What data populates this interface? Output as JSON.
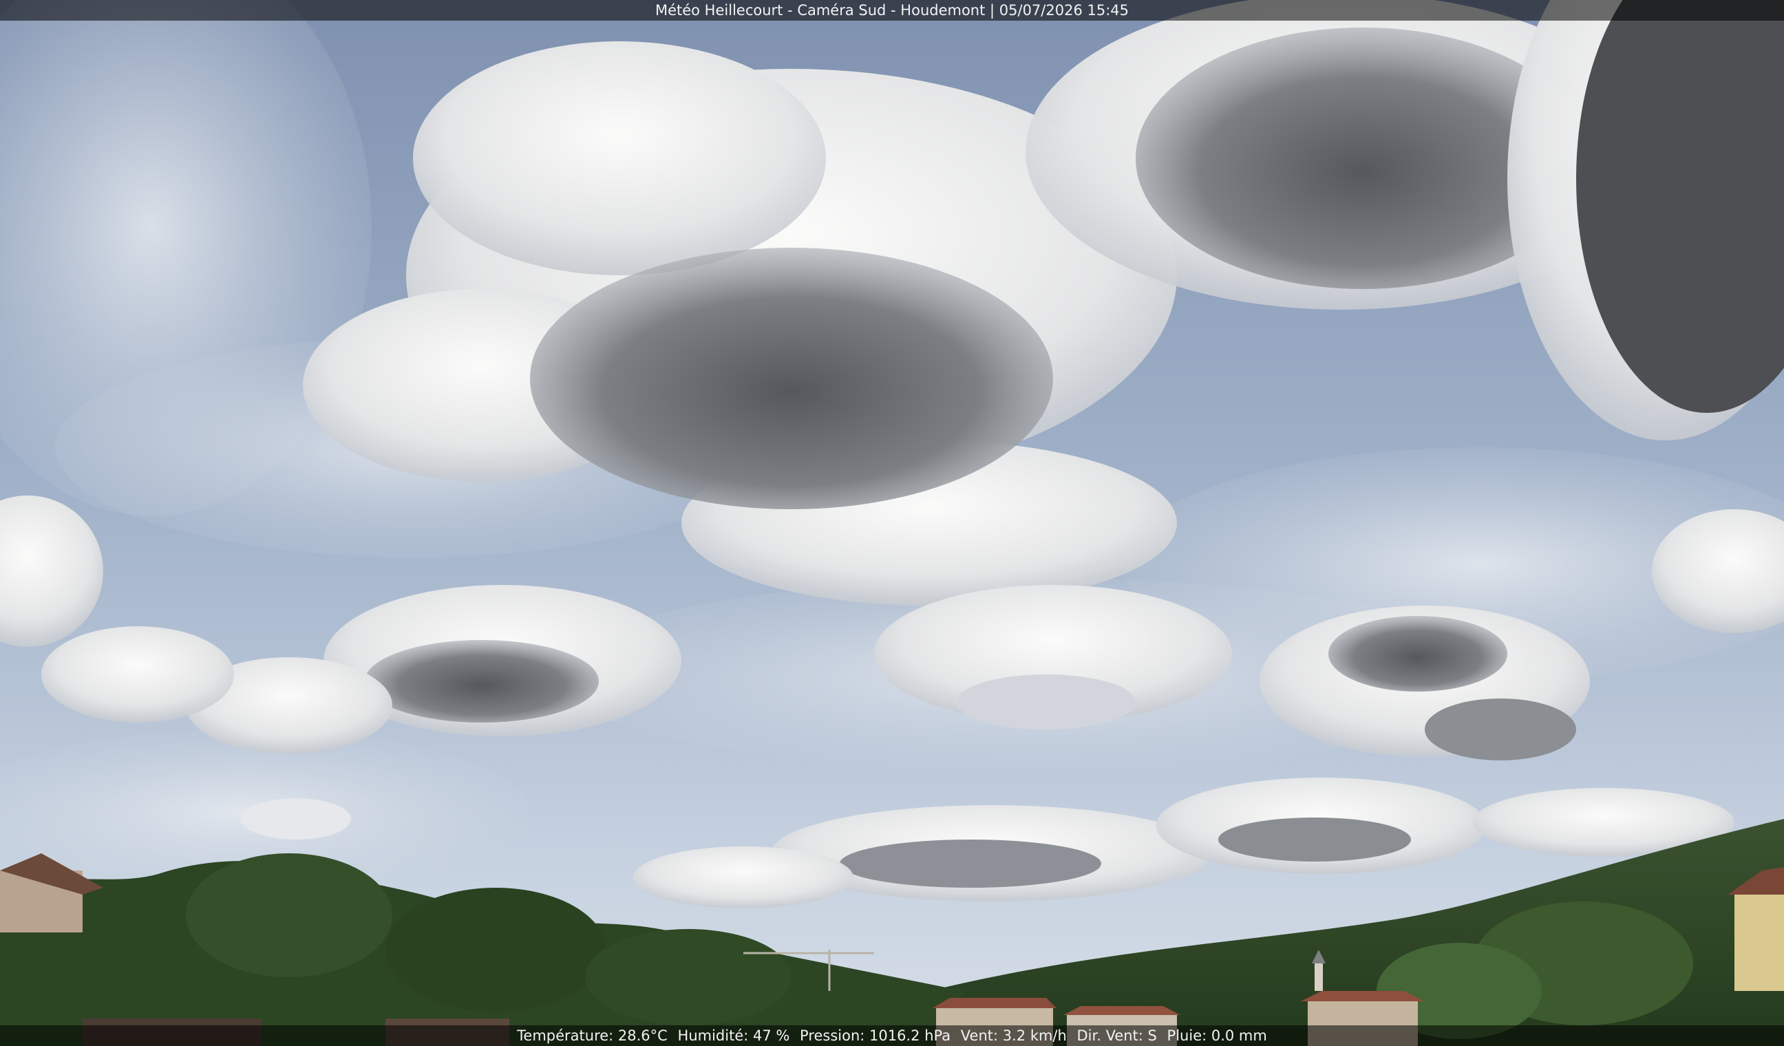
{
  "camera": {
    "title": "Météo Heillecourt - Caméra Sud - Houdemont | 05/07/2026 15:45"
  },
  "weather": {
    "temperature": "Température: 28.6°C",
    "humidity": "Humidité: 47 %",
    "pressure": "Pression: 1016.2 hPa",
    "wind": "Vent: 3.2 km/h",
    "wind_dir": "Dir. Vent: S",
    "rain": "Pluie: 0.0 mm"
  },
  "colors": {
    "sky_top": "#8a9bb8",
    "sky_horizon": "#c9d4e2",
    "cloud_light": "#f4f4f2",
    "cloud_dark": "#5e6064",
    "vegetation": "#2f4a25"
  }
}
